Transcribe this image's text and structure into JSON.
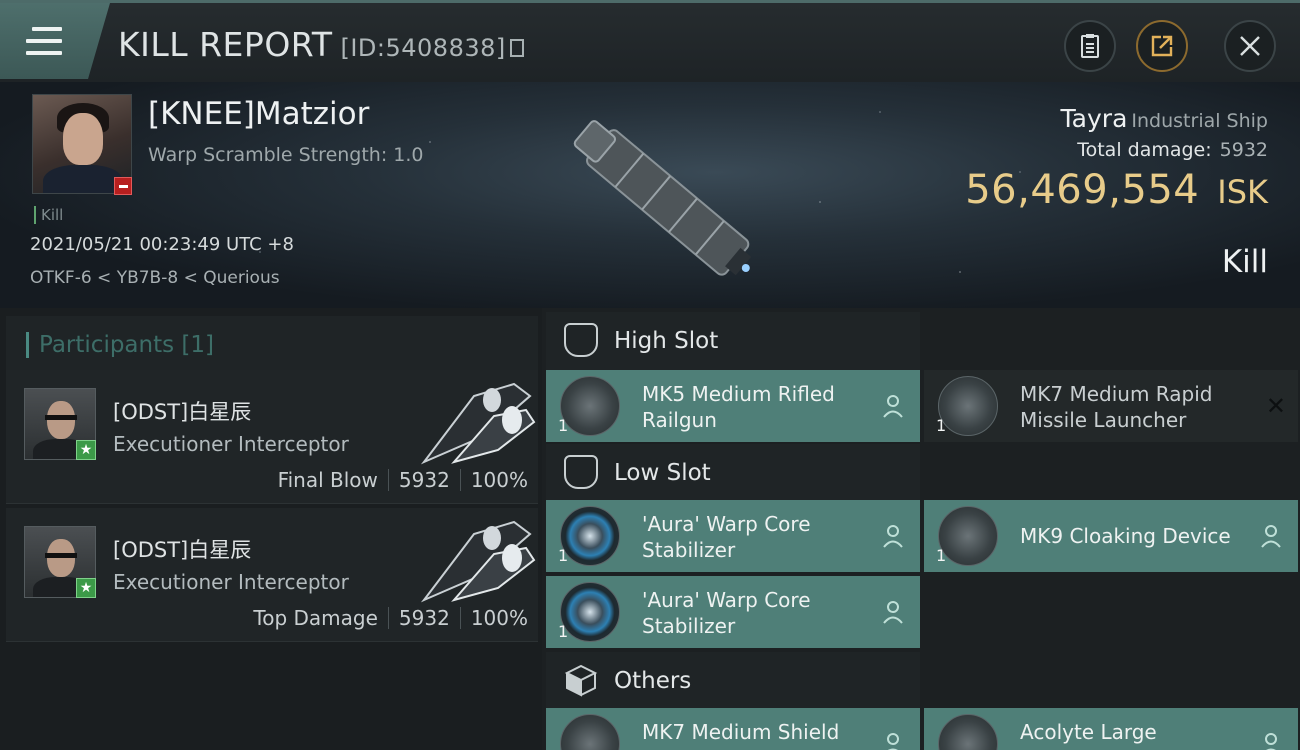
{
  "header": {
    "title": "KILL REPORT",
    "kill_id": "[ID:5408838]",
    "icons": {
      "menu": "menu-icon",
      "clipboard": "clipboard-icon",
      "share": "share-icon",
      "close": "close-icon"
    }
  },
  "victim": {
    "name": "[KNEE]Matzior",
    "warp_scramble": "Warp Scramble Strength: 1.0",
    "kill_tag": "Kill",
    "datetime": "2021/05/21 00:23:49 UTC +8",
    "location": "OTKF-6 < YB7B-8 < Querious",
    "ship_name": "Tayra",
    "ship_class": "Industrial Ship",
    "total_damage_label": "Total damage:",
    "total_damage": "5932",
    "isk_value": "56,469,554",
    "isk_unit": "ISK",
    "result": "Kill"
  },
  "participants": {
    "title": "Participants [1]",
    "rows": [
      {
        "name": "[ODST]白星辰",
        "ship": "Executioner Interceptor",
        "role": "Final Blow",
        "damage": "5932",
        "percent": "100%"
      },
      {
        "name": "[ODST]白星辰",
        "ship": "Executioner Interceptor",
        "role": "Top Damage",
        "damage": "5932",
        "percent": "100%"
      }
    ]
  },
  "fitting": {
    "high_slot": {
      "label": "High Slot",
      "modules": [
        {
          "qty": "1",
          "name": "MK5 Medium Rifled Railgun"
        },
        {
          "qty": "1",
          "name": "MK7 Medium Rapid Missile Launcher"
        }
      ]
    },
    "low_slot": {
      "label": "Low Slot",
      "modules": [
        {
          "qty": "1",
          "name": "'Aura' Warp Core Stabilizer"
        },
        {
          "qty": "1",
          "name": "MK9 Cloaking Device"
        },
        {
          "qty": "1",
          "name": "'Aura' Warp Core Stabilizer"
        }
      ]
    },
    "others": {
      "label": "Others",
      "modules": [
        {
          "name": "MK7 Medium Shield"
        },
        {
          "name": "Acolyte Large"
        }
      ]
    }
  },
  "colors": {
    "accent_teal": "#4f7f78",
    "isk_gold": "#e8cc8a",
    "badge_red": "#b71f1f",
    "badge_green": "#3c9a48"
  }
}
